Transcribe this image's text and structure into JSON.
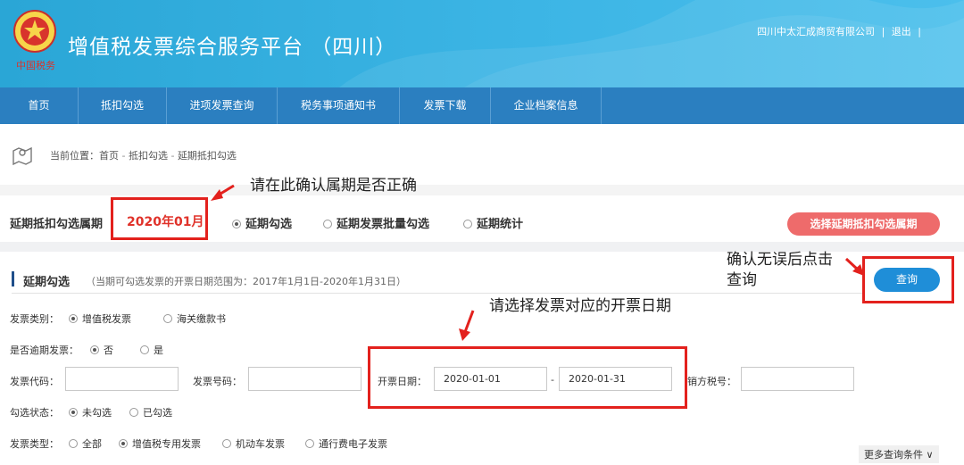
{
  "header": {
    "title": "增值税发票综合服务平台 （四川）",
    "emblem_text": "中国税务",
    "company": "四川中太汇成商贸有限公司",
    "separator": "|",
    "logout": "退出"
  },
  "nav": {
    "items": [
      {
        "label": "首页"
      },
      {
        "label": "抵扣勾选"
      },
      {
        "label": "进项发票查询"
      },
      {
        "label": "税务事项通知书"
      },
      {
        "label": "发票下载"
      },
      {
        "label": "企业档案信息"
      }
    ]
  },
  "breadcrumb": {
    "prefix": "当前位置：",
    "home": "首页",
    "sep": " - ",
    "level1": "抵扣勾选",
    "level2": "延期抵扣勾选"
  },
  "period": {
    "label": "延期抵扣勾选属期",
    "value": "2020年01月",
    "tabs": [
      {
        "label": "延期勾选",
        "selected": true
      },
      {
        "label": "延期发票批量勾选",
        "selected": false
      },
      {
        "label": "延期统计",
        "selected": false
      }
    ],
    "select_button": "选择延期抵扣勾选属期"
  },
  "section": {
    "title": "延期勾选",
    "hint": "（当期可勾选发票的开票日期范围为：2017年1月1日-2020年1月31日）",
    "query_button": "查询"
  },
  "form": {
    "invoice_category": {
      "label": "发票类别：",
      "options": [
        {
          "label": "增值税发票",
          "selected": true
        },
        {
          "label": "海关缴款书",
          "selected": false
        }
      ]
    },
    "overdue": {
      "label": "是否逾期发票：",
      "options": [
        {
          "label": "否",
          "selected": true
        },
        {
          "label": "是",
          "selected": false
        }
      ]
    },
    "invoice_code": {
      "label": "发票代码：",
      "value": ""
    },
    "invoice_number": {
      "label": "发票号码：",
      "value": ""
    },
    "issue_date": {
      "label": "开票日期：",
      "from": "2020-01-01",
      "dash": "-",
      "to": "2020-01-31"
    },
    "seller_tax_id": {
      "label": "销方税号：",
      "value": ""
    },
    "check_status": {
      "label": "勾选状态：",
      "options": [
        {
          "label": "未勾选",
          "selected": true
        },
        {
          "label": "已勾选",
          "selected": false
        }
      ]
    },
    "invoice_type": {
      "label": "发票类型：",
      "options": [
        {
          "label": "全部",
          "selected": false
        },
        {
          "label": "增值税专用发票",
          "selected": true
        },
        {
          "label": "机动车发票",
          "selected": false
        },
        {
          "label": "通行费电子发票",
          "selected": false
        }
      ]
    },
    "more_conditions": "更多查询条件 ∨"
  },
  "annotations": {
    "period_note": "请在此确认属期是否正确",
    "query_note_line1": "确认无误后点击",
    "query_note_line2": "查询",
    "date_note": "请选择发票对应的开票日期"
  },
  "colors": {
    "header": "#3cb5e5",
    "nav": "#2b7fc0",
    "accent_red": "#e3211d",
    "query_button": "#1f8ed8",
    "period_button": "#ee6b6b"
  }
}
